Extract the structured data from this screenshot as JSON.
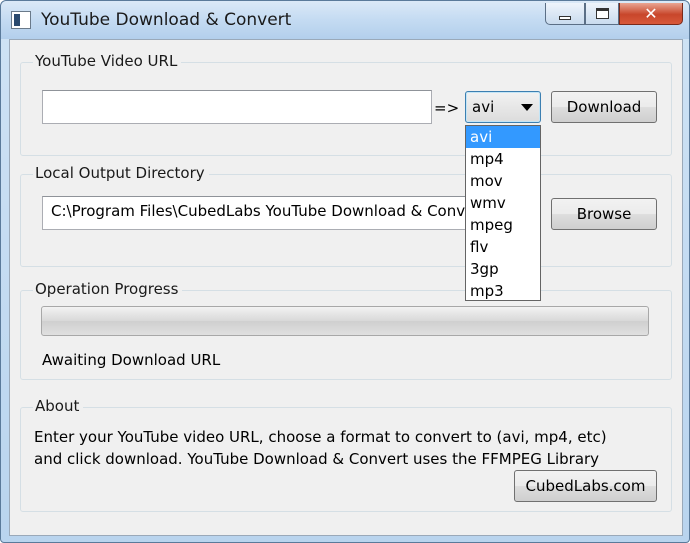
{
  "window": {
    "title": "YouTube Download & Convert"
  },
  "url_group": {
    "label": "YouTube Video URL",
    "url_value": "",
    "arrow": "=>",
    "format_selected": "avi",
    "format_options": [
      "avi",
      "mp4",
      "mov",
      "wmv",
      "mpeg",
      "flv",
      "3gp",
      "mp3"
    ],
    "download_label": "Download"
  },
  "output_group": {
    "label": "Local Output Directory",
    "directory_value": "C:\\Program Files\\CubedLabs YouTube Download & Convert",
    "browse_label": "Browse"
  },
  "progress_group": {
    "label": "Operation Progress",
    "progress_fraction": 0,
    "status_text": "Awaiting Download URL"
  },
  "about_group": {
    "label": "About",
    "line1": "Enter your YouTube video URL, choose a format to convert to (avi, mp4, etc)",
    "line2": "and click download. YouTube Download & Convert uses the FFMPEG Library",
    "link_label": "CubedLabs.com"
  },
  "colors": {
    "selection": "#3399ff",
    "close_button": "#c8462b"
  }
}
